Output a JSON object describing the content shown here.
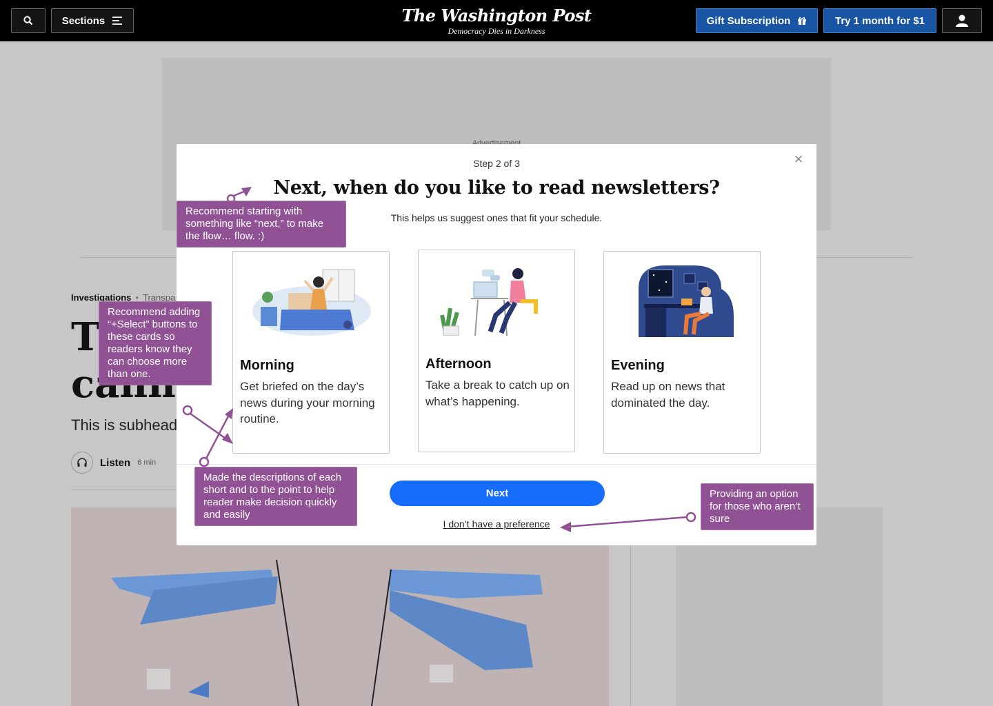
{
  "nav": {
    "sections_label": "Sections",
    "logo": "The Washington Post",
    "tagline": "Democracy Dies in Darkness",
    "gift_label": "Gift Subscription",
    "try_label": "Try 1 month for $1"
  },
  "article": {
    "ad_label": "Advertisement",
    "kicker": "Investigations",
    "kicker_sub": "Transpa",
    "headline_line1": "Tl",
    "headline_line2": "cannot",
    "subhead": "This is subhead",
    "listen_label": "Listen",
    "listen_time": "6 min"
  },
  "modal": {
    "step": "Step 2 of 3",
    "title": "Next, when do you like to read newsletters?",
    "subtitle": "This helps us suggest ones that fit your schedule.",
    "close": "×",
    "cards": [
      {
        "title": "Morning",
        "desc": "Get briefed on the day’s news during your morning routine."
      },
      {
        "title": "Afternoon",
        "desc": "Take a break to catch up on what’s happening."
      },
      {
        "title": "Evening",
        "desc": "Read up on news that dominated the day."
      }
    ],
    "next_label": "Next",
    "no_pref_label": "I don’t have a preference"
  },
  "annotations": {
    "next_note": "Recommend starting with something like “next,” to make the flow… flow. :)",
    "select_note": "Recommend adding “+Select” buttons to these cards so readers know they can choose more than one.",
    "desc_note": "Made the descriptions of each short and to the point to help reader make decision quickly and easily",
    "pref_note": "Providing an option for those who aren’t sure"
  },
  "colors": {
    "accent_blue": "#166dfc",
    "nav_blue": "#1955a5",
    "annotation_purple": "#915295"
  },
  "icons": [
    "search-icon",
    "menu-icon",
    "gift-icon",
    "user-icon",
    "headphones-icon",
    "close-icon"
  ]
}
